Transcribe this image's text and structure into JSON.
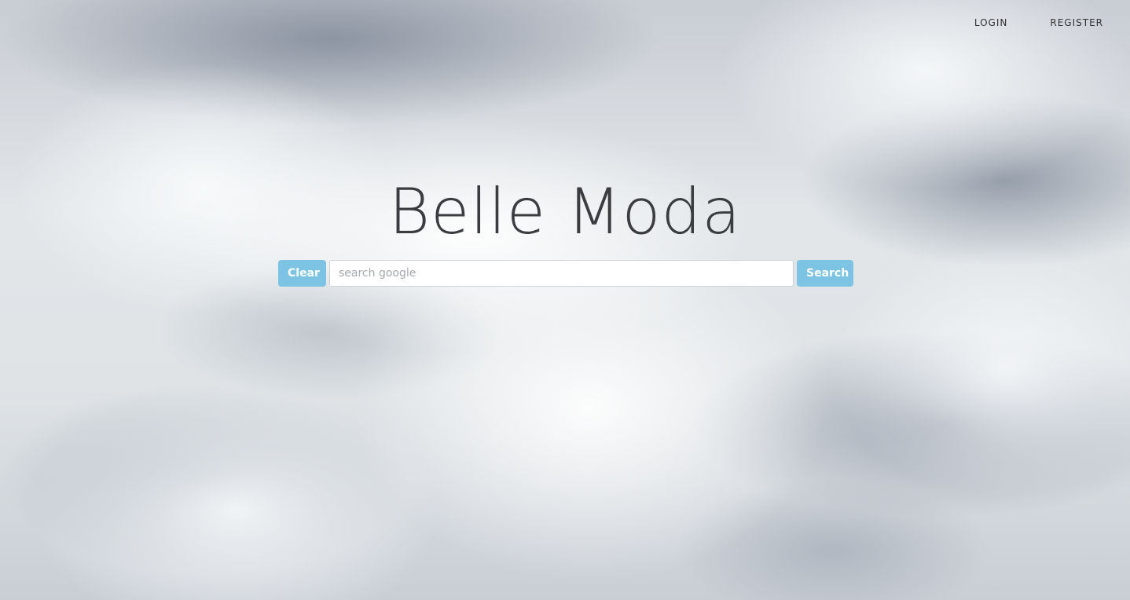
{
  "nav": {
    "login_label": "LOGIN",
    "register_label": "REGISTER"
  },
  "brand": {
    "title": "Belle Moda"
  },
  "search": {
    "clear_label": "Clear",
    "placeholder": "search google",
    "value": "",
    "submit_label": "Search"
  },
  "colors": {
    "button_accent": "#7dc3e3",
    "title_text": "#3a3c40",
    "nav_text": "#333333"
  },
  "background": {
    "description_icon": "cloudy-sky-background"
  }
}
